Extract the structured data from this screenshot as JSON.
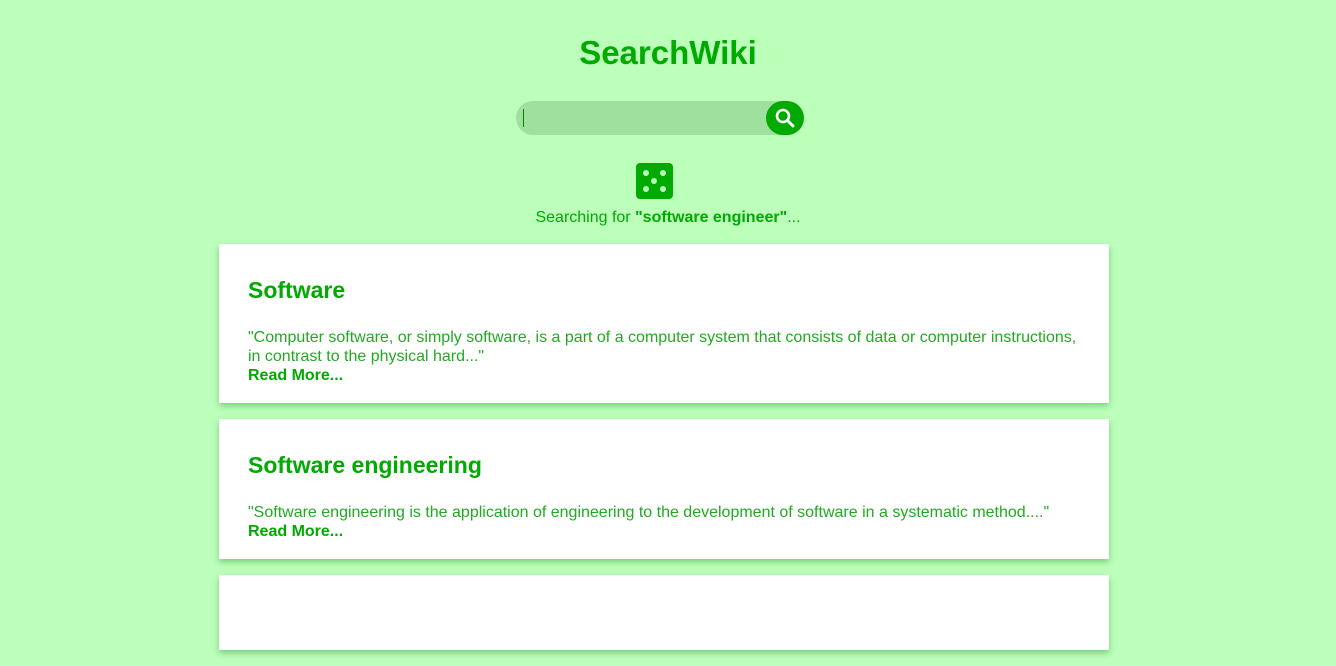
{
  "app": {
    "title": "SearchWiki"
  },
  "search": {
    "value": "",
    "placeholder": ""
  },
  "icons": {
    "search": "search-icon",
    "random": "dice-five-icon"
  },
  "status": {
    "prefix": "Searching for ",
    "query": "\"software engineer\"",
    "suffix": "..."
  },
  "results": [
    {
      "title": "Software",
      "snippet": "\"Computer software, or simply software, is a part of a computer system that consists of data or computer instructions, in contrast to the physical hard...\"",
      "more": "Read More..."
    },
    {
      "title": "Software engineering",
      "snippet": "\"Software engineering is the application of engineering to the development of software in a systematic method....\"",
      "more": "Read More..."
    },
    {
      "title": "",
      "snippet": "",
      "more": ""
    }
  ],
  "colors": {
    "background": "#bbffbb",
    "accent": "#00aa00",
    "card": "#ffffff"
  }
}
